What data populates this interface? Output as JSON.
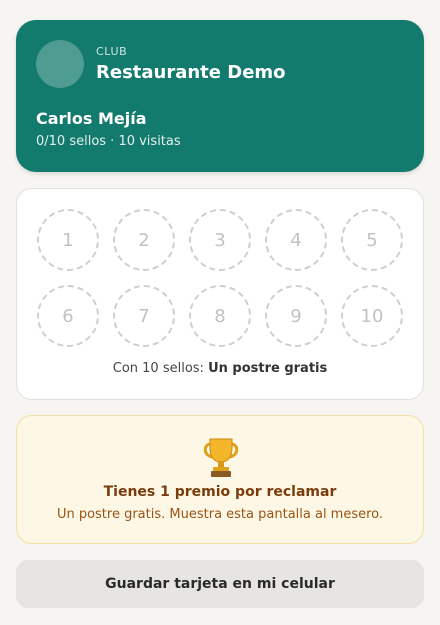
{
  "header": {
    "club_label": "CLUB",
    "restaurant_name": "Restaurante Demo",
    "member_name": "Carlos Mejía",
    "member_stats": "0/10 sellos · 10 visitas"
  },
  "stamps": {
    "filled": 0,
    "total": 10,
    "items": [
      "1",
      "2",
      "3",
      "4",
      "5",
      "6",
      "7",
      "8",
      "9",
      "10"
    ],
    "reward_prefix": "Con 10 sellos: ",
    "reward_text": "Un postre gratis"
  },
  "prize": {
    "icon": "trophy-icon",
    "title": "Tienes 1 premio por reclamar",
    "description": "Un postre gratis. Muestra esta pantalla al mesero."
  },
  "actions": {
    "save_label": "Guardar tarjeta en mi celular"
  },
  "colors": {
    "brand": "#137a6e",
    "prize_bg": "#fdf8e6",
    "prize_title": "#7a3c0c"
  }
}
